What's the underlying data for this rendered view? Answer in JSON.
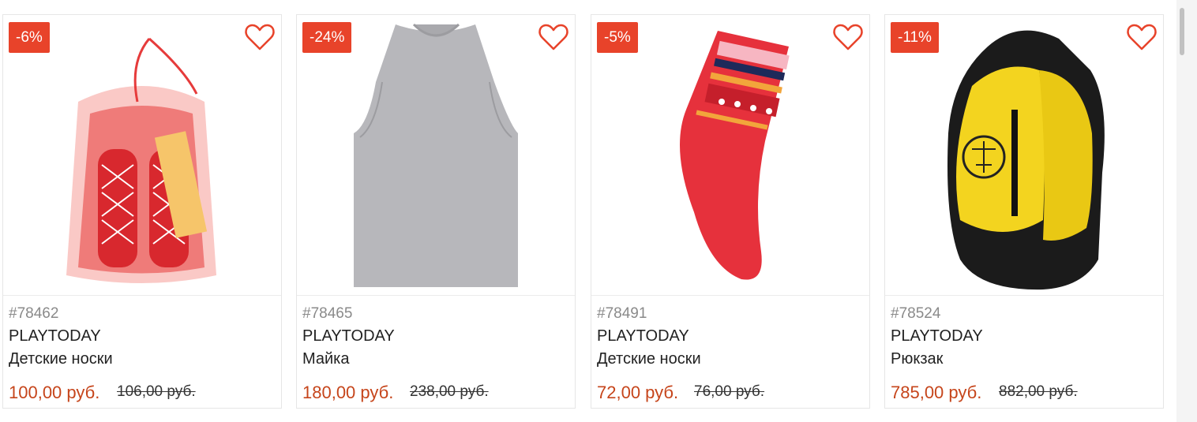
{
  "colors": {
    "accent": "#e8432a",
    "price": "#c6451b"
  },
  "products": [
    {
      "discount": "-6%",
      "sku": "#78462",
      "brand": "PLAYTODAY",
      "name": "Детские носки",
      "price": "100,00 руб.",
      "old_price": "106,00 руб.",
      "image_icon": "gift-bag-socks-image"
    },
    {
      "discount": "-24%",
      "sku": "#78465",
      "brand": "PLAYTODAY",
      "name": "Майка",
      "price": "180,00 руб.",
      "old_price": "238,00 руб.",
      "image_icon": "tank-top-image"
    },
    {
      "discount": "-5%",
      "sku": "#78491",
      "brand": "PLAYTODAY",
      "name": "Детские носки",
      "price": "72,00 руб.",
      "old_price": "76,00 руб.",
      "image_icon": "red-sock-image"
    },
    {
      "discount": "-11%",
      "sku": "#78524",
      "brand": "PLAYTODAY",
      "name": "Рюкзак",
      "price": "785,00 руб.",
      "old_price": "882,00 руб.",
      "image_icon": "backpack-image"
    }
  ]
}
